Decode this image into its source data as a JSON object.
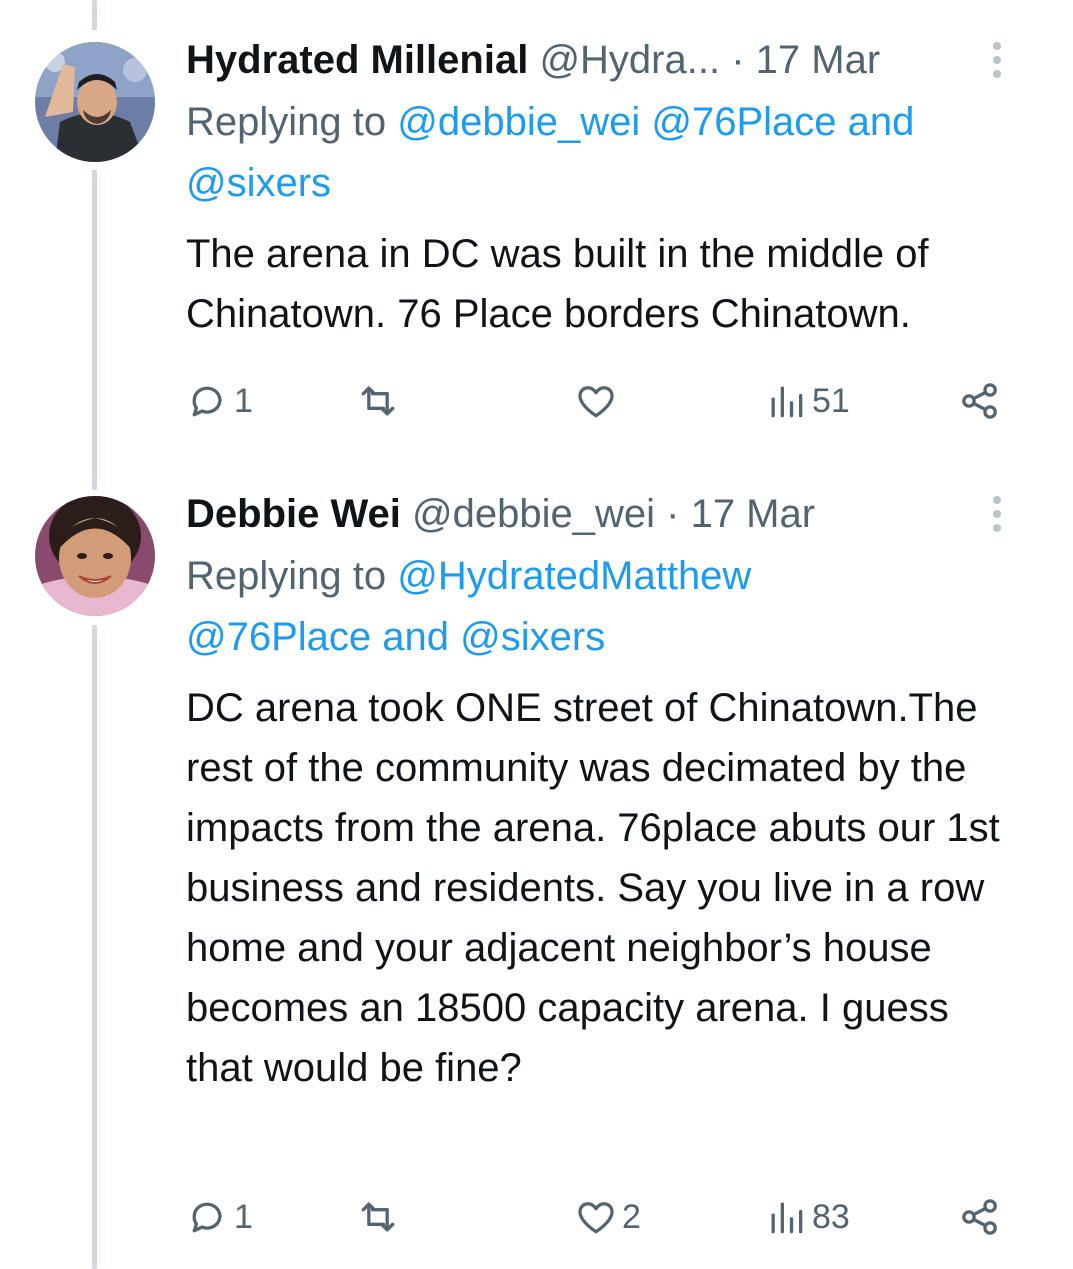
{
  "tweets": [
    {
      "name": "Hydrated Millenial",
      "handle": "@Hydra...",
      "dot": "·",
      "date": "17 Mar",
      "replying_prefix": "Replying to ",
      "mentions": [
        "@debbie_wei",
        "@76Place",
        "@sixers"
      ],
      "and": "and",
      "body": "The arena in DC was built in the middle of Chinatown. 76 Place borders Chinatown.",
      "replies": "1",
      "retweets": "",
      "likes": "",
      "views": "51",
      "avatar_icon": "profile-photo"
    },
    {
      "name": "Debbie Wei",
      "handle": "@debbie_wei",
      "dot": "·",
      "date": "17 Mar",
      "replying_prefix": "Replying to ",
      "mentions": [
        "@HydratedMatthew",
        "@76Place",
        "@sixers"
      ],
      "and": "and",
      "body": "DC arena took ONE street of Chinatown.The rest of the community was decimated by the impacts from the arena. 76place abuts our 1st business and residents. Say you live in a row home and your adjacent neighbor’s house becomes an 18500 capacity arena. I guess that would be fine?",
      "replies": "1",
      "retweets": "",
      "likes": "2",
      "views": "83",
      "avatar_icon": "profile-photo"
    }
  ],
  "icons": {
    "reply": "speech-bubble-icon",
    "retweet": "retweet-icon",
    "like": "heart-icon",
    "views": "bar-chart-icon",
    "share": "share-icon",
    "more": "vertical-dots-icon"
  },
  "colors": {
    "text": "#0f1419",
    "secondary": "#536471",
    "link": "#1d9bf0",
    "thread_line": "#cfd9de"
  }
}
